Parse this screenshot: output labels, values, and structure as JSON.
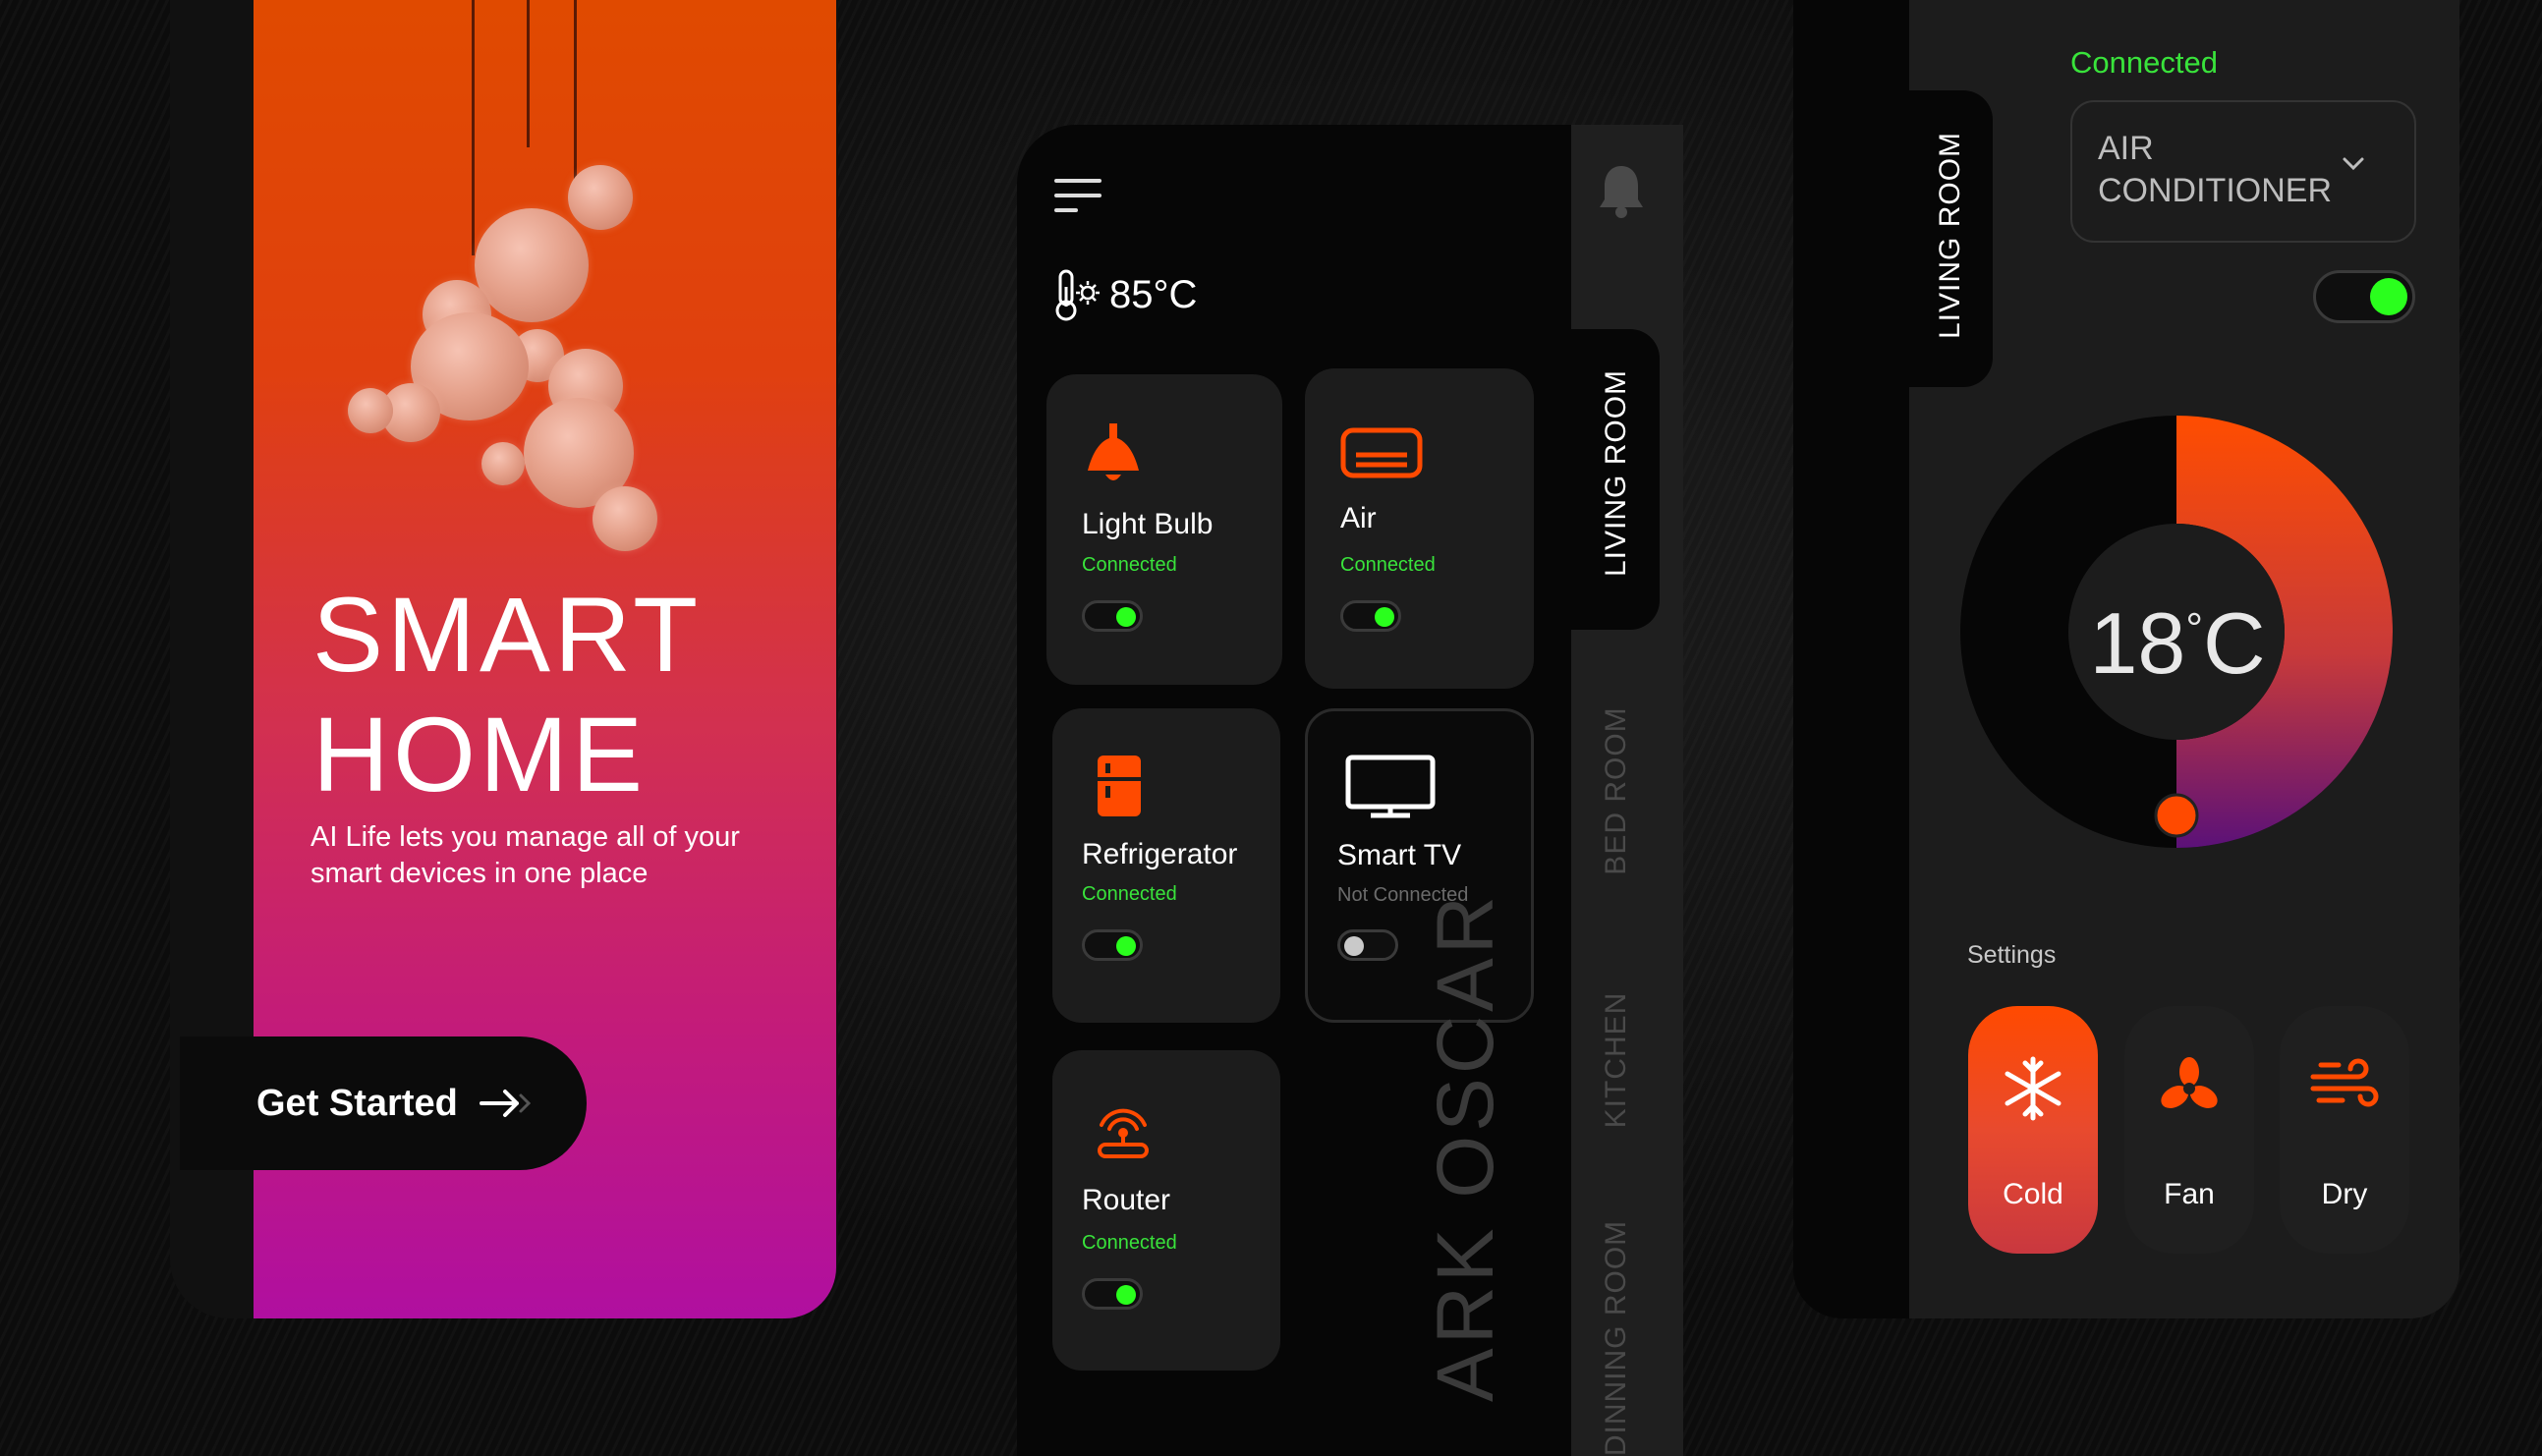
{
  "colors": {
    "accent": "#ff4a00",
    "connected": "#39e33b",
    "toggle_on": "#2aff1d",
    "gradient_top": "#e04a00",
    "gradient_bottom": "#b00fa0"
  },
  "welcome": {
    "title_line1": "SMART",
    "title_line2": "HOME",
    "description": "AI Life lets you manage all of your smart devices in one place",
    "cta_label": "Get Started"
  },
  "dashboard": {
    "weather": "85°C",
    "devices": [
      {
        "name": "Light Bulb",
        "status": "Connected",
        "icon": "light-bulb-icon",
        "on": true
      },
      {
        "name": "Air",
        "status": "Connected",
        "icon": "air-conditioner-icon",
        "on": true
      },
      {
        "name": "Refrigerator",
        "status": "Connected",
        "icon": "refrigerator-icon",
        "on": true
      },
      {
        "name": "Smart TV",
        "status": "Not Connected",
        "icon": "tv-icon",
        "on": false
      },
      {
        "name": "Router",
        "status": "Connected",
        "icon": "router-icon",
        "on": true
      }
    ],
    "watermark": "ARK OSCAR",
    "rooms": [
      "LIVING ROOM",
      "BED ROOM",
      "KITCHEN",
      "DINNING ROOM"
    ],
    "active_room": "LIVING ROOM"
  },
  "ac_control": {
    "room_tab": "LIVING ROOM",
    "connection_status": "Connected",
    "device_select": "AIR CONDITIONER",
    "power_on": true,
    "temperature_value": "18",
    "temperature_unit": "C",
    "settings_label": "Settings",
    "modes": [
      {
        "label": "Cold",
        "icon": "snowflake-icon",
        "active": true
      },
      {
        "label": "Fan",
        "icon": "fan-icon",
        "active": false
      },
      {
        "label": "Dry",
        "icon": "wind-icon",
        "active": false
      }
    ]
  }
}
